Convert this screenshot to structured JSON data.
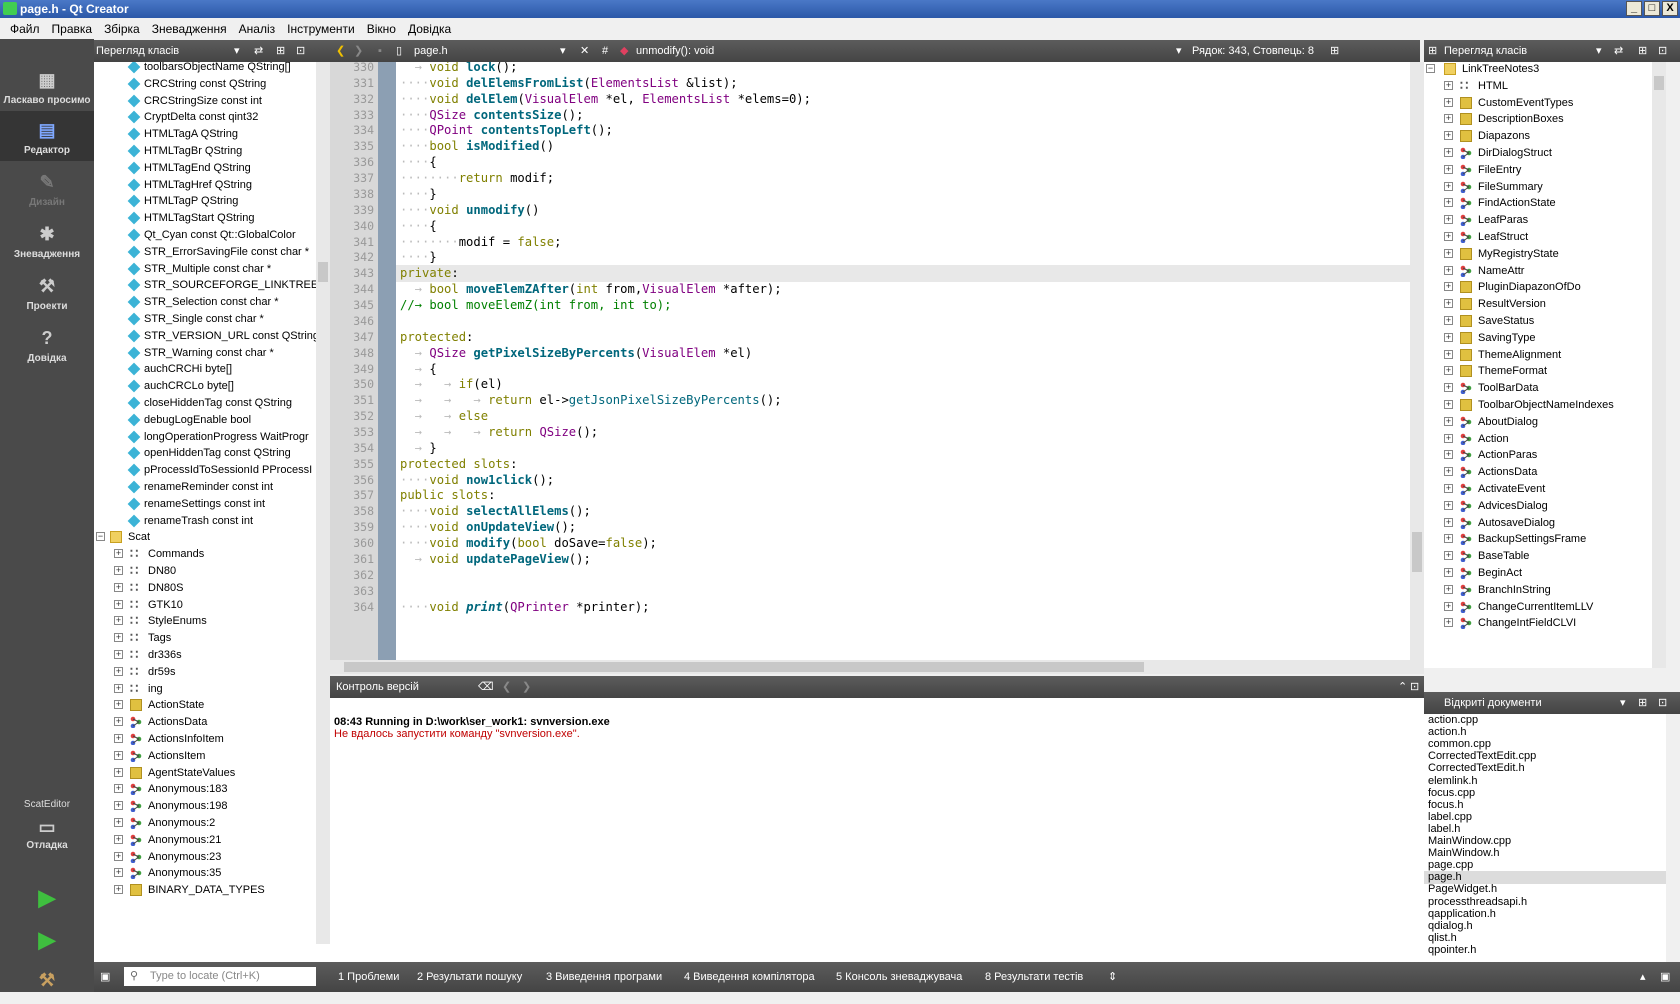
{
  "window": {
    "title": "page.h - Qt Creator",
    "buttons": [
      "_",
      "□",
      "X"
    ]
  },
  "menu": [
    "Файл",
    "Правка",
    "Збірка",
    "Зневадження",
    "Аналіз",
    "Інструменти",
    "Вікно",
    "Довідка"
  ],
  "modes": [
    {
      "label": "Ласкаво просимо",
      "icon": "grid-icon"
    },
    {
      "label": "Редактор",
      "icon": "editor-icon"
    },
    {
      "label": "Дизайн",
      "icon": "design-icon"
    },
    {
      "label": "Зневадження",
      "icon": "debug-icon"
    },
    {
      "label": "Проекти",
      "icon": "wrench-icon"
    },
    {
      "label": "Довідка",
      "icon": "help-icon"
    }
  ],
  "kit": {
    "project": "ScatEditor",
    "mode": "Отладка"
  },
  "left_panel": {
    "title": "Перегляд класів",
    "vars": [
      "toolbarsObjectName QString[]",
      "CRCString const QString",
      "CRCStringSize const int",
      "CryptDelta const qint32",
      "HTMLTagA QString",
      "HTMLTagBr QString",
      "HTMLTagEnd QString",
      "HTMLTagHref QString",
      "HTMLTagP QString",
      "HTMLTagStart QString",
      "Qt_Cyan const Qt::GlobalColor",
      "STR_ErrorSavingFile const char *",
      "STR_Multiple const char *",
      "STR_SOURCEFORGE_LINKTREEN",
      "STR_Selection const char *",
      "STR_Single const char *",
      "STR_VERSION_URL const QString",
      "STR_Warning const char *",
      "auchCRCHi byte[]",
      "auchCRCLo byte[]",
      "closeHiddenTag const QString",
      "debugLogEnable bool",
      "longOperationProgress WaitProgr",
      "openHiddenTag const QString",
      "pProcessIdToSessionId PProcessI",
      "renameReminder const int",
      "renameSettings const int",
      "renameTrash const int"
    ],
    "folder": "Scat",
    "children": [
      {
        "t": "ns",
        "n": "Commands"
      },
      {
        "t": "ns",
        "n": "DN80"
      },
      {
        "t": "ns",
        "n": "DN80S"
      },
      {
        "t": "ns",
        "n": "GTK10"
      },
      {
        "t": "ns",
        "n": "StyleEnums"
      },
      {
        "t": "ns",
        "n": "Tags"
      },
      {
        "t": "ns",
        "n": "dr336s"
      },
      {
        "t": "ns",
        "n": "dr59s"
      },
      {
        "t": "ns",
        "n": "ing"
      },
      {
        "t": "cls",
        "n": "ActionState"
      },
      {
        "t": "struct",
        "n": "ActionsData"
      },
      {
        "t": "struct",
        "n": "ActionsInfoItem"
      },
      {
        "t": "struct",
        "n": "ActionsItem"
      },
      {
        "t": "cls",
        "n": "AgentStateValues"
      },
      {
        "t": "struct",
        "n": "Anonymous:183"
      },
      {
        "t": "struct",
        "n": "Anonymous:198"
      },
      {
        "t": "struct",
        "n": "Anonymous:2"
      },
      {
        "t": "struct",
        "n": "Anonymous:21"
      },
      {
        "t": "struct",
        "n": "Anonymous:23"
      },
      {
        "t": "struct",
        "n": "Anonymous:35"
      },
      {
        "t": "cls",
        "n": "BINARY_DATA_TYPES"
      }
    ]
  },
  "editor": {
    "file": "page.h",
    "symbol": "unmodify(): void",
    "position": "Рядок: 343, Стовпець: 8",
    "hash": "#",
    "lines": [
      {
        "n": "330",
        "h": "<span class='ws'>  → </span><span class='kw'>void</span> <span class='fn'>lock</span>();"
      },
      {
        "n": "331",
        "h": "<span class='ws'>····</span><span class='kw'>void</span> <span class='fn'>delElemsFromList</span>(<span class='ty'>ElementsList</span> &amp;list);"
      },
      {
        "n": "332",
        "h": "<span class='ws'>····</span><span class='kw'>void</span> <span class='fn'>delElem</span>(<span class='ty'>VisualElem</span> *el, <span class='ty'>ElementsList</span> *elems=0);"
      },
      {
        "n": "333",
        "h": "<span class='ws'>····</span><span class='ty'>QSize</span> <span class='fn'>contentsSize</span>();"
      },
      {
        "n": "334",
        "h": "<span class='ws'>····</span><span class='ty'>QPoint</span> <span class='fn'>contentsTopLeft</span>();"
      },
      {
        "n": "335",
        "h": "<span class='ws'>····</span><span class='kw'>bool</span> <span class='fn'>isModified</span>()"
      },
      {
        "n": "336",
        "h": "<span class='ws'>····</span>{"
      },
      {
        "n": "337",
        "h": "<span class='ws'>········</span><span class='kw'>return</span> modif;"
      },
      {
        "n": "338",
        "h": "<span class='ws'>····</span>}"
      },
      {
        "n": "339",
        "h": "<span class='ws'>····</span><span class='kw'>void</span> <span class='fn'>unmodify</span>()"
      },
      {
        "n": "340",
        "h": "<span class='ws'>····</span>{"
      },
      {
        "n": "341",
        "h": "<span class='ws'>········</span>modif = <span class='kw'>false</span>;"
      },
      {
        "n": "342",
        "h": "<span class='ws'>····</span>}"
      },
      {
        "n": "343",
        "h": "<span class='kw'>private</span>:",
        "cur": true
      },
      {
        "n": "344",
        "h": "<span class='ws'>  → </span><span class='kw'>bool</span> <span class='fn'>moveElemZAfter</span>(<span class='kw'>int</span> from,<span class='ty'>VisualElem</span> *after);"
      },
      {
        "n": "345",
        "h": "<span style='color:#008000'>//→ bool moveElemZ(int from, int to);</span>"
      },
      {
        "n": "346",
        "h": ""
      },
      {
        "n": "347",
        "h": "<span class='kw'>protected</span>:"
      },
      {
        "n": "348",
        "h": "<span class='ws'>  → </span><span class='ty'>QSize</span> <span class='fn'>getPixelSizeByPercents</span>(<span class='ty'>VisualElem</span> *el)"
      },
      {
        "n": "349",
        "h": "<span class='ws'>  → </span>{"
      },
      {
        "n": "350",
        "h": "<span class='ws'>  →   → </span><span class='kw'>if</span>(el)"
      },
      {
        "n": "351",
        "h": "<span class='ws'>  →   →   → </span><span class='kw'>return</span> el-&gt;<span style='color:#00677c'>getJsonPixelSizeByPercents</span>();"
      },
      {
        "n": "352",
        "h": "<span class='ws'>  →   → </span><span class='kw'>else</span>"
      },
      {
        "n": "353",
        "h": "<span class='ws'>  →   →   → </span><span class='kw'>return</span> <span class='ty'>QSize</span>();"
      },
      {
        "n": "354",
        "h": "<span class='ws'>  → </span>}"
      },
      {
        "n": "355",
        "h": "<span class='kw'>protected</span> <span class='kw'>slots</span>:"
      },
      {
        "n": "356",
        "h": "<span class='ws'>····</span><span class='kw'>void</span> <span class='fn'>now1click</span>();"
      },
      {
        "n": "357",
        "h": "<span class='kw'>public</span> <span class='kw'>slots</span>:"
      },
      {
        "n": "358",
        "h": "<span class='ws'>····</span><span class='kw'>void</span> <span class='fn'>selectAllElems</span>();"
      },
      {
        "n": "359",
        "h": "<span class='ws'>····</span><span class='kw'>void</span> <span class='fn'>onUpdateView</span>();"
      },
      {
        "n": "360",
        "h": "<span class='ws'>····</span><span class='kw'>void</span> <span class='fn'>modify</span>(<span class='kw'>bool</span> doSave=<span class='kw'>false</span>);"
      },
      {
        "n": "361",
        "h": "<span class='ws'>  → </span><span class='kw'>void</span> <span class='fn'>updatePageView</span>();"
      },
      {
        "n": "362",
        "h": ""
      },
      {
        "n": "363",
        "h": ""
      },
      {
        "n": "364",
        "h": "<span class='ws'>····</span><span class='kw'>void</span> <span class='it'>print</span>(<span class='ty'>QPrinter</span> *printer);"
      }
    ]
  },
  "vc": {
    "title": "Контроль версій",
    "running": "08:43 Running in D:\\work\\ser_work1: svnversion.exe",
    "error": "Не вдалось запустити команду \"svnversion.exe\"."
  },
  "right_panel": {
    "title": "Перегляд класів",
    "root": "LinkTreeNotes3",
    "items": [
      {
        "t": "ns",
        "n": "HTML"
      },
      {
        "t": "cls",
        "n": "CustomEventTypes"
      },
      {
        "t": "cls",
        "n": "DescriptionBoxes"
      },
      {
        "t": "cls",
        "n": "Diapazons"
      },
      {
        "t": "struct",
        "n": "DirDialogStruct"
      },
      {
        "t": "struct",
        "n": "FileEntry"
      },
      {
        "t": "struct",
        "n": "FileSummary"
      },
      {
        "t": "struct",
        "n": "FindActionState"
      },
      {
        "t": "struct",
        "n": "LeafParas"
      },
      {
        "t": "struct",
        "n": "LeafStruct"
      },
      {
        "t": "cls",
        "n": "MyRegistryState"
      },
      {
        "t": "struct",
        "n": "NameAttr"
      },
      {
        "t": "cls",
        "n": "PluginDiapazonOfDo"
      },
      {
        "t": "cls",
        "n": "ResultVersion"
      },
      {
        "t": "cls",
        "n": "SaveStatus"
      },
      {
        "t": "cls",
        "n": "SavingType"
      },
      {
        "t": "cls",
        "n": "ThemeAlignment"
      },
      {
        "t": "cls",
        "n": "ThemeFormat"
      },
      {
        "t": "struct",
        "n": "ToolBarData"
      },
      {
        "t": "cls",
        "n": "ToolbarObjectNameIndexes"
      },
      {
        "t": "struct",
        "n": "AboutDialog"
      },
      {
        "t": "struct",
        "n": "Action"
      },
      {
        "t": "struct",
        "n": "ActionParas"
      },
      {
        "t": "struct",
        "n": "ActionsData"
      },
      {
        "t": "struct",
        "n": "ActivateEvent"
      },
      {
        "t": "struct",
        "n": "AdvicesDialog"
      },
      {
        "t": "struct",
        "n": "AutosaveDialog"
      },
      {
        "t": "struct",
        "n": "BackupSettingsFrame"
      },
      {
        "t": "struct",
        "n": "BaseTable"
      },
      {
        "t": "struct",
        "n": "BeginAct"
      },
      {
        "t": "struct",
        "n": "BranchInString"
      },
      {
        "t": "struct",
        "n": "ChangeCurrentItemLLV"
      },
      {
        "t": "struct",
        "n": "ChangeIntFieldCLVI"
      }
    ]
  },
  "open_docs": {
    "title": "Відкриті документи",
    "selected": "page.h",
    "files": [
      "action.cpp",
      "action.h",
      "common.cpp",
      "CorrectedTextEdit.cpp",
      "CorrectedTextEdit.h",
      "elemlink.h",
      "focus.cpp",
      "focus.h",
      "label.cpp",
      "label.h",
      "MainWindow.cpp",
      "MainWindow.h",
      "page.cpp",
      "page.h",
      "PageWidget.h",
      "processthreadsapi.h",
      "qapplication.h",
      "qdialog.h",
      "qlist.h",
      "qpointer.h"
    ]
  },
  "statusbar": {
    "locate_placeholder": "Type to locate (Ctrl+K)",
    "tabs": [
      "1  Проблеми",
      "2  Результати пошуку",
      "3  Виведення програми",
      "4  Виведення компілятора",
      "5  Консоль зневаджувача",
      "8  Результати тестів"
    ]
  },
  "colors": {
    "accent": "#4a78c7",
    "modebar": "#4a4a4a",
    "fold": "#8c9fb3"
  }
}
